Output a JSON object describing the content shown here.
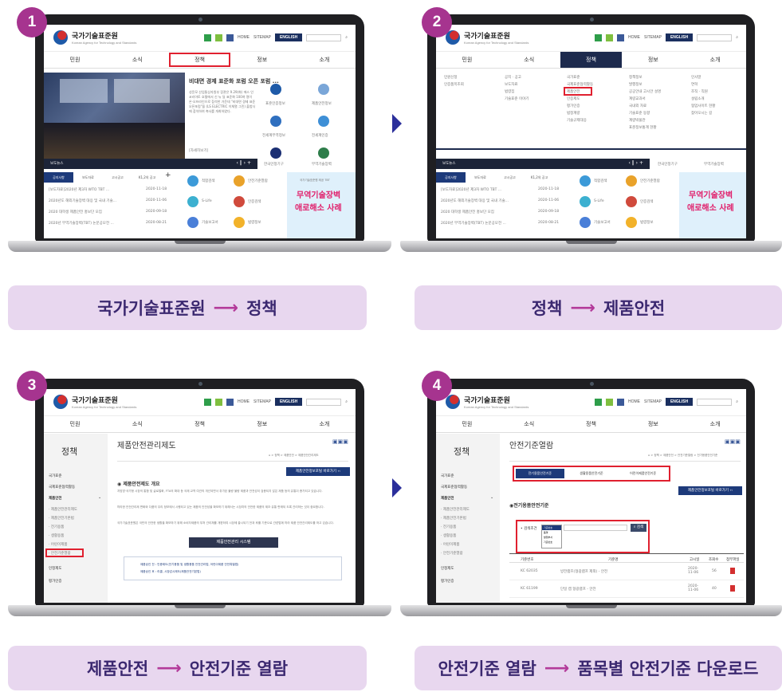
{
  "steps": [
    {
      "number": "1",
      "from": "국가기술표준원",
      "to": "정책"
    },
    {
      "number": "2",
      "from": "정책",
      "to": "제품안전"
    },
    {
      "number": "3",
      "from": "제품안전",
      "to": "안전기준 열람"
    },
    {
      "number": "4",
      "from": "안전기준 열람",
      "to": "품목별 안전기준 다운로드"
    }
  ],
  "caption_arrow": "⟶",
  "site": {
    "logo_ko": "국가기술표준원",
    "logo_en": "Korean Agency for Technology and Standards",
    "util": {
      "home": "HOME",
      "sitemap": "SITEMAP",
      "english": "ENGLISH"
    },
    "nav": [
      "민원",
      "소식",
      "정책",
      "정보",
      "소개"
    ]
  },
  "screen1": {
    "headline": "비대면 경제 표준화 포럼 오픈 포럼 ...",
    "body": "성윤모 산업통상자원부 장관은 9.29(화) 에스 인코리아토 호텔에서 신 뉴 딜 표준화 100여 명이 온·오프라인으로 참석한 가운데 \"비대면 경제 표준 오픈포럼\"을 (LS ELECTRIC 이체열 그린) 출범식에 참석하여 축사를 개최하였다.",
    "more": "[자세히보기]",
    "slider_label": "보도뉴스",
    "quick": [
      "표준인증정보",
      "제품안전정보",
      "전세계무역정보",
      "전세계인증",
      "한국인정기구",
      "무역기술장벽"
    ],
    "tabs": [
      "공지사항",
      "보도자료",
      "고시공고",
      "K1,2의 공고"
    ],
    "news": [
      {
        "title": "[보도자료]2020년 제3차 WTO TBT ...",
        "date": "2020-11-18"
      },
      {
        "title": "2020년도 해외기술장벽 대응 및 국내 기술...",
        "date": "2020-11-06"
      },
      {
        "title": "2020 대학생 제품안전 홍보단 모집",
        "date": "2020-09-18"
      },
      {
        "title": "2020년 무역기술장벽(TBT) 논문공모전 ...",
        "date": "2020-08-21"
      }
    ],
    "services": [
      "적합검색",
      "안전기준열람",
      "S-Life",
      "인증검색",
      "기술보고서",
      "법령정보"
    ],
    "banner_small": "국가기술표준원 제공 TBT",
    "banner_title_1": "무역기술장벽",
    "banner_title_2": "애로해소 사례"
  },
  "screen2": {
    "columns": [
      [
        "민원신청",
        "인증품목조회"
      ],
      [
        "공지 · 공고",
        "보도자료",
        "법령집",
        "기술표준 이야기"
      ],
      [
        "국가표준",
        "국제표준협력활동",
        "제품안전",
        "인증제도",
        "평가인증",
        "법정계량",
        "기술규제대응"
      ],
      [
        "정책정보",
        "발행정보",
        "공공안내 고시안 설명",
        "계량교과서",
        "국내외 자료",
        "기술표준 동향",
        "계량박물관",
        "표준정보통계 현황"
      ],
      [
        "인사말",
        "연혁",
        "조직 · 직원",
        "설립소개",
        "협업사이트 현황",
        "찾아오시는 길"
      ]
    ],
    "highlight": "제품안전",
    "banner_title_1": "무역기술장벽",
    "banner_title_2": "애로해소 사례"
  },
  "screen3": {
    "side_title": "정책",
    "side_menu": [
      "국가표준",
      "국제표준협력활동",
      "제품안전",
      "· 제품안전관리제도",
      "· 제품안전기본법",
      "· 전기용품",
      "· 생활용품",
      "· 어린이제품",
      "· 안전기준열람",
      "인정제도",
      "평가인증"
    ],
    "page_title": "제품안전관리제도",
    "breadcrumb": "⌂ > 정책 > 제품안전 > 제품안전관리제도",
    "link_button": "제품안전정보포털 바로가기 ‹‹",
    "section_title": "제품안전제도 개요",
    "para1": "지방방·국가형 시장의 통합 및 글로벌화, FTA의 확대 등 국제 교역 여건의 개선되면서 취가된 불량 불량 제품과 안전성이 검증되지 않은 제품 등의 유통이 증가되고 있습니다.",
    "para2": "따라한 안전관리제 변화와 다품의 우리 정보에서 시행되고 있는 제품의 안전성을 확보하기 위해서는 시장치의 안전한 제품의 제조·유통·판매되 도록 관리하는 것이 중요합니다.",
    "para3": "국가기술표준원은 국민의 안전한 생활을 확보하기 위해 소비자제품의 부처 관리체를 개편하여 시장에 출시되기 전과 후를 기준으로 관련법에 따라 제품 안전관리제도를 하고 있습니다.",
    "system_button": "제품안전관리 시스템",
    "note1": "제품승인 전 : 인증제도(전기용품 및 생활용품 안전관리법, 어린이제품 안전특별법)",
    "note2": "제품승인 후 : 리콜, 시장감시제도(제품안전기본법)"
  },
  "screen4": {
    "side_title": "정책",
    "side_menu": [
      "국가표준",
      "국제표준협력활동",
      "제품안전",
      "· 제품안전관리제도",
      "· 제품안전기본법",
      "· 전기용품",
      "· 생활용품",
      "· 어린이제품",
      "· 안전기준열람",
      "인정제도",
      "평가인증"
    ],
    "page_title": "안전기준열람",
    "breadcrumb": "⌂ > 정책 > 제품안전 > 안전기준열람 > 전기용품안전기준",
    "tabs": [
      "전기용품안전기준",
      "생활용품안전기준",
      "어린이제품안전기준"
    ],
    "link_button": "제품안전정보포털 바로가기 ‹‹",
    "section_title": "전기용품안전기준",
    "search_label": "검색조건",
    "search_options": [
      "기준번호",
      "품명",
      "발행부서",
      "기준번호"
    ],
    "search_button": "검색",
    "table_headers": [
      "기준번호",
      "기준명",
      "고시일",
      "조회수",
      "첨부파일"
    ],
    "rows": [
      {
        "code": "KC 62035",
        "name": "방전램프(형광램프 제외) - 안전",
        "date": "2020-11-06",
        "views": "56"
      },
      {
        "code": "KC 61199",
        "name": "단일 캡 형광램프 - 안전",
        "date": "2020-11-06",
        "views": "40"
      }
    ]
  },
  "colors": {
    "badge": "#a6348f",
    "caption_bg": "#e8d7ef",
    "caption_text": "#3b2870",
    "arrow": "#2b2f9b",
    "highlight": "#e0202f"
  }
}
